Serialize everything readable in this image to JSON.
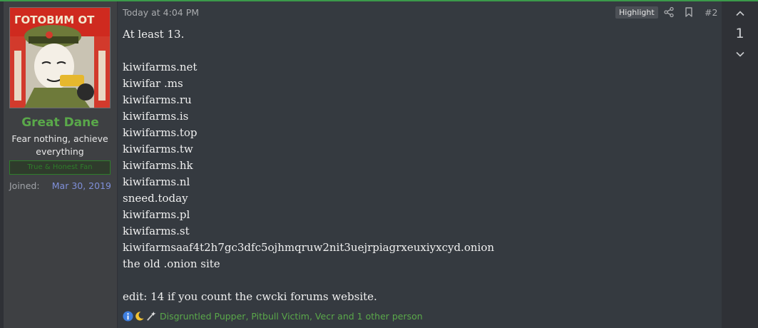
{
  "user": {
    "name": "Great Dane",
    "title": "Fear nothing, achieve everything",
    "banner": "True & Honest Fan",
    "joined_label": "Joined:",
    "joined_date": "Mar 30, 2019",
    "avatar_text": "ГОТОВИМ ОТ"
  },
  "post": {
    "timestamp": "Today at 4:04 PM",
    "highlight_label": "Highlight",
    "number": "#2",
    "lines": [
      "At least 13.",
      "",
      "kiwifarms.net",
      "kiwifar .ms",
      "kiwifarms.ru",
      "kiwifarms.is",
      "kiwifarms.top",
      "kiwifarms.tw",
      "kiwifarms.hk",
      "kiwifarms.nl",
      "sneed.today",
      "kiwifarms.pl",
      "kiwifarms.st",
      "kiwifarmsaaf4t2h7gc3dfc5ojhmqruw2nit3uejrpiagrxeuxiyxcyd.onion",
      "the old .onion site",
      "",
      "edit: 14 if you count the cwcki forums website."
    ],
    "reactions_text": "Disgruntled Pupper, Pitbull Victim, Vecr and 1 other person"
  },
  "vote": {
    "count": "1"
  },
  "colors": {
    "accent_green": "#5aa84a",
    "joined_blue": "#7f8fd9",
    "panel_bg": "#3e4043",
    "message_bg": "#353a40"
  },
  "icons": [
    "share-icon",
    "bookmark-icon",
    "chevron-up-icon",
    "chevron-down-icon",
    "info-icon",
    "moon-icon",
    "wand-icon"
  ]
}
